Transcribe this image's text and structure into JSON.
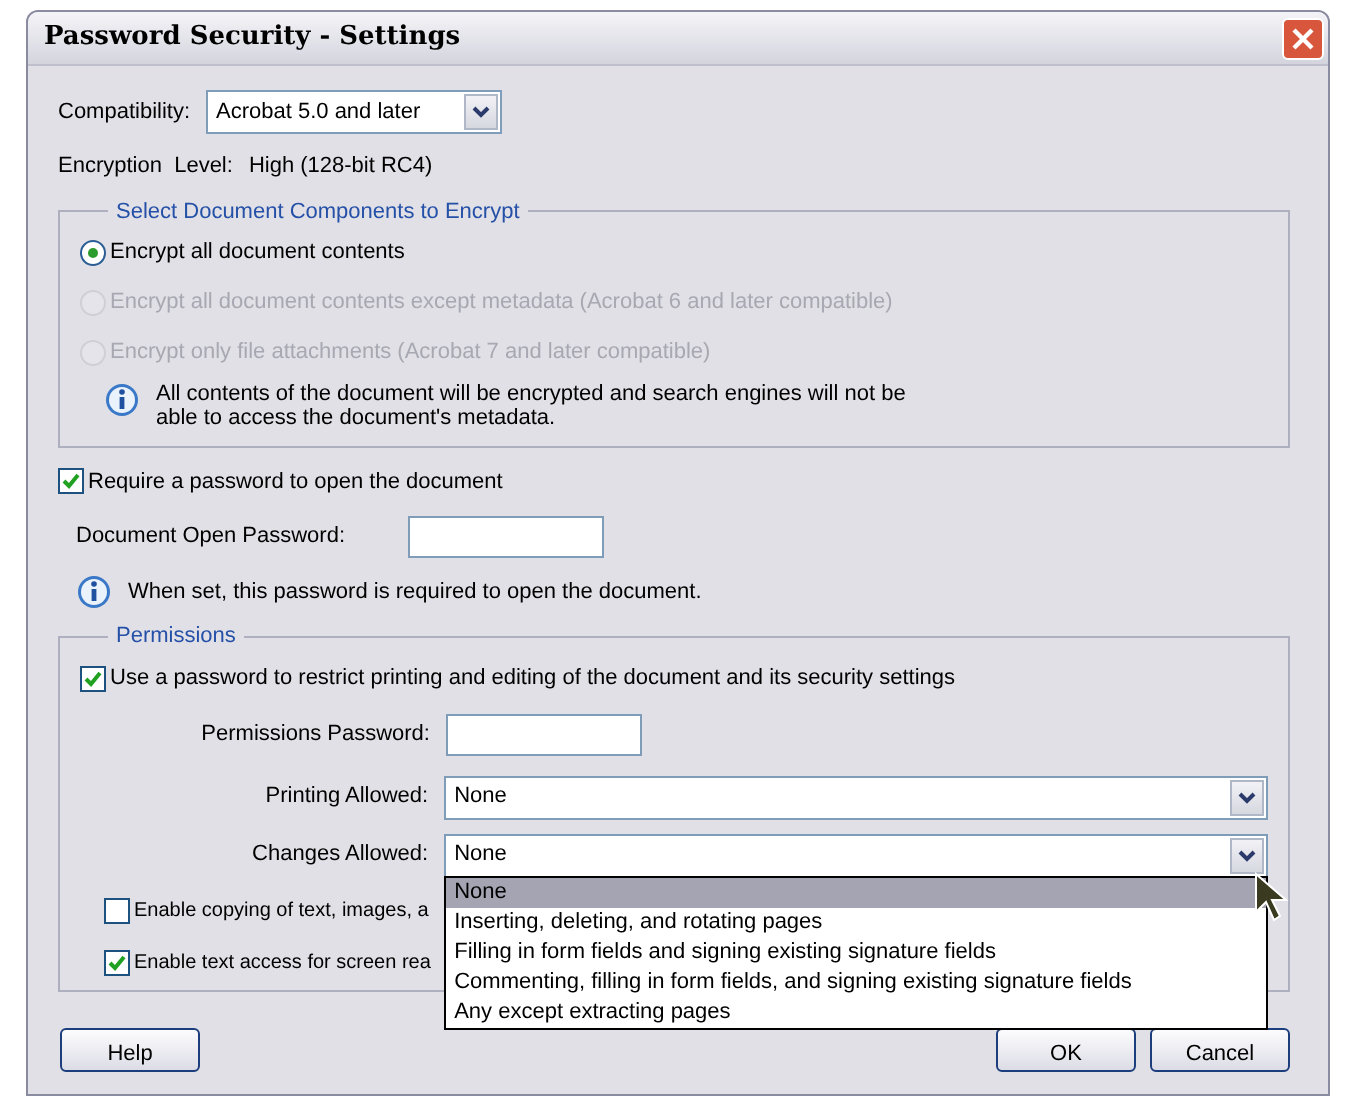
{
  "window": {
    "title": "Password Security - Settings"
  },
  "compatibility": {
    "label": "Compatibility:",
    "value": "Acrobat 5.0 and later"
  },
  "encryption_level": {
    "label": "Encryption  Level:",
    "value": "High (128-bit RC4)"
  },
  "components": {
    "legend": "Select Document Components to Encrypt",
    "options": [
      {
        "label": "Encrypt all document contents",
        "selected": true,
        "disabled": false
      },
      {
        "label": "Encrypt all document contents except metadata (Acrobat 6 and later compatible)",
        "selected": false,
        "disabled": true
      },
      {
        "label": "Encrypt only file attachments (Acrobat 7 and later compatible)",
        "selected": false,
        "disabled": true
      }
    ],
    "info": "All contents of the document will be encrypted and search engines will not be able to access the document's metadata."
  },
  "require_open_password": {
    "label": "Require a password to open the document",
    "checked": true
  },
  "open_password": {
    "label": "Document Open Password:"
  },
  "open_password_info": "When set, this password is required to open the document.",
  "permissions": {
    "legend": "Permissions",
    "restrict": {
      "label": "Use a password to restrict printing and editing of the document and its security settings",
      "checked": true
    },
    "password_label": "Permissions Password:",
    "printing": {
      "label": "Printing Allowed:",
      "value": "None"
    },
    "changes": {
      "label": "Changes Allowed:",
      "value": "None",
      "expanded": true,
      "options": [
        {
          "label": "None",
          "selected": true
        },
        {
          "label": "Inserting, deleting, and rotating pages",
          "selected": false
        },
        {
          "label": "Filling in form fields and signing existing signature fields",
          "selected": false
        },
        {
          "label": "Commenting, filling in form fields, and signing existing signature fields",
          "selected": false
        },
        {
          "label": "Any except extracting pages",
          "selected": false
        }
      ]
    },
    "checkboxes": [
      {
        "label": "Enable copying of text, images, a",
        "checked": false
      },
      {
        "label": "Enable text access for screen rea",
        "checked": true
      }
    ]
  },
  "buttons": [
    "Help",
    "OK",
    "Cancel"
  ]
}
